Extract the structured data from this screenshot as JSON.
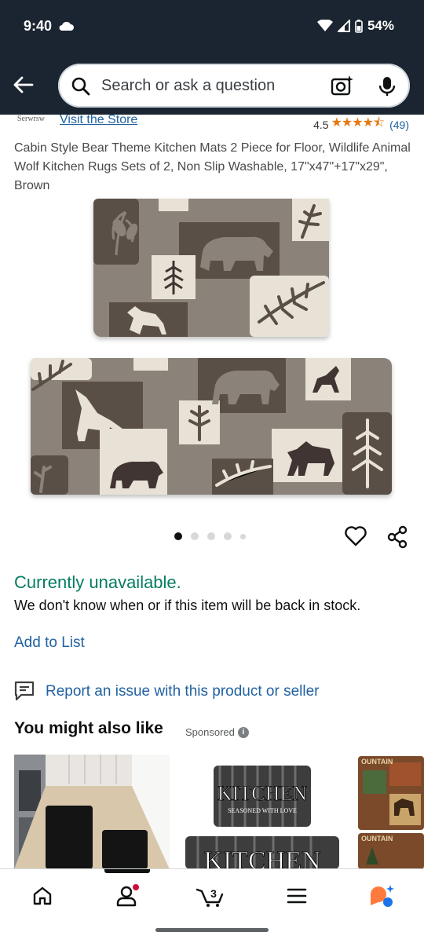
{
  "status_bar": {
    "time": "9:40",
    "battery": "54%"
  },
  "search": {
    "placeholder": "Search or ask a question"
  },
  "store": {
    "logo_text": "Serwrsw",
    "link": "Visit the Store"
  },
  "rating": {
    "value": "4.5",
    "stars": "★★★★⯪",
    "count": "(49)"
  },
  "product": {
    "title": "Cabin Style Bear Theme Kitchen Mats 2 Piece for Floor, Wildlife Animal Wolf Kitchen Rugs Sets of 2, Non Slip Washable, 17\"x47\"+17\"x29\", Brown",
    "image_count": 5,
    "active_image": 1
  },
  "availability": {
    "status": "Currently unavailable.",
    "message": "We don't know when or if this item will be back in stock."
  },
  "actions": {
    "add_to_list": "Add to List",
    "report": "Report an issue with this product or seller"
  },
  "recommendations": {
    "heading": "You might also like",
    "sponsored": "Sponsored",
    "items": [
      {
        "name": "black kitchen mats",
        "text": ""
      },
      {
        "name": "kitchen mats",
        "text1": "KITCHEN",
        "text2": "SEASONED WITH LOVE",
        "text3": "KITCHEN"
      },
      {
        "name": "cabin mats",
        "text": "OUNTAIN"
      }
    ]
  },
  "bottom_nav": {
    "items": [
      "home",
      "account",
      "cart",
      "menu",
      "rufus"
    ],
    "cart_count": "3",
    "active": "account"
  },
  "colors": {
    "header_bg": "#1b2531",
    "link": "#2162a1",
    "unavailable": "#067d62",
    "star": "#e47911"
  }
}
